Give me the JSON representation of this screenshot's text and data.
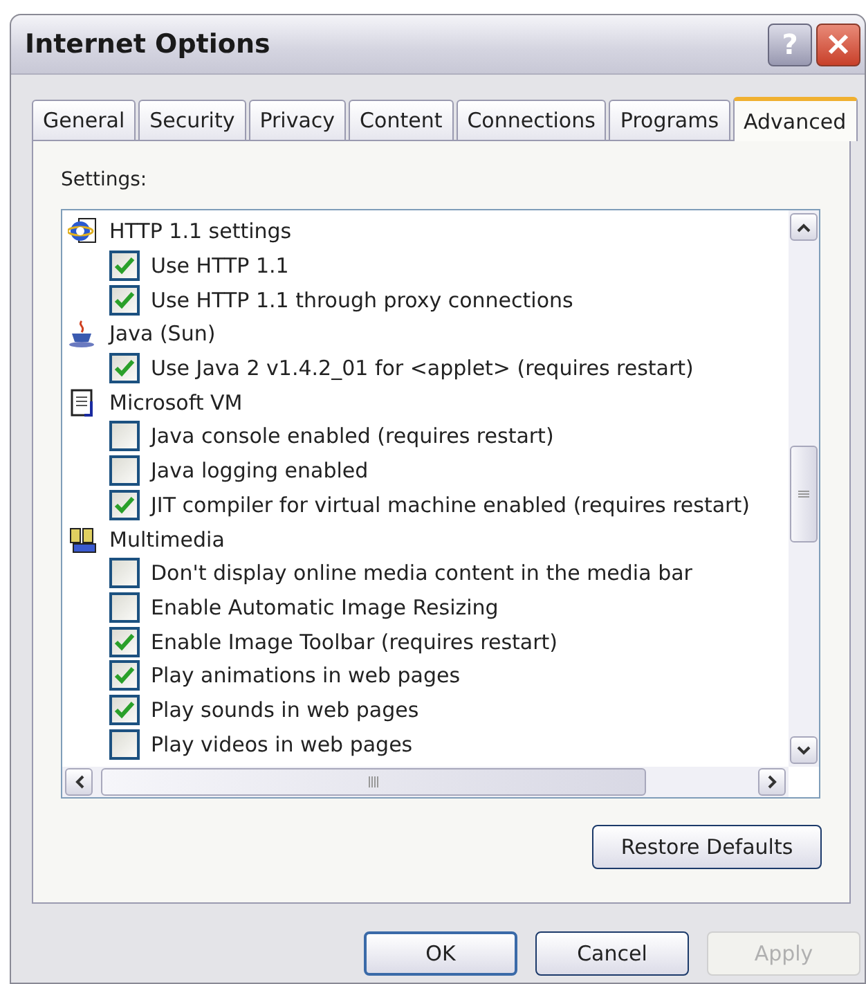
{
  "window": {
    "title": "Internet Options",
    "help": "?"
  },
  "tabs": [
    {
      "label": "General",
      "selected": false
    },
    {
      "label": "Security",
      "selected": false
    },
    {
      "label": "Privacy",
      "selected": false
    },
    {
      "label": "Content",
      "selected": false
    },
    {
      "label": "Connections",
      "selected": false
    },
    {
      "label": "Programs",
      "selected": false
    },
    {
      "label": "Advanced",
      "selected": true
    }
  ],
  "settings_label": "Settings:",
  "settings": [
    {
      "label": "HTTP 1.1 settings",
      "kind": "globe",
      "children": [
        {
          "label": "Use HTTP 1.1",
          "checked": true
        },
        {
          "label": "Use HTTP 1.1 through proxy connections",
          "checked": true
        }
      ]
    },
    {
      "label": "Java (Sun)",
      "kind": "cup",
      "children": [
        {
          "label": "Use Java 2 v1.4.2_01 for <applet> (requires restart)",
          "checked": true
        }
      ]
    },
    {
      "label": "Microsoft VM",
      "kind": "document",
      "children": [
        {
          "label": "Java console enabled (requires restart)",
          "checked": false
        },
        {
          "label": "Java logging enabled",
          "checked": false
        },
        {
          "label": "JIT compiler for virtual machine enabled (requires restart)",
          "checked": true
        }
      ]
    },
    {
      "label": "Multimedia",
      "kind": "media",
      "children": [
        {
          "label": "Don't display online media content in the media bar",
          "checked": false
        },
        {
          "label": "Enable Automatic Image Resizing",
          "checked": false
        },
        {
          "label": "Enable Image Toolbar (requires restart)",
          "checked": true
        },
        {
          "label": "Play animations in web pages",
          "checked": true
        },
        {
          "label": "Play sounds in web pages",
          "checked": true
        },
        {
          "label": "Play videos in web pages",
          "checked": false
        }
      ]
    }
  ],
  "restore_button": "Restore Defaults",
  "buttons": [
    {
      "label": "OK",
      "default": true,
      "disabled": false
    },
    {
      "label": "Cancel",
      "default": false,
      "disabled": false
    },
    {
      "label": "Apply",
      "default": false,
      "disabled": true
    }
  ]
}
